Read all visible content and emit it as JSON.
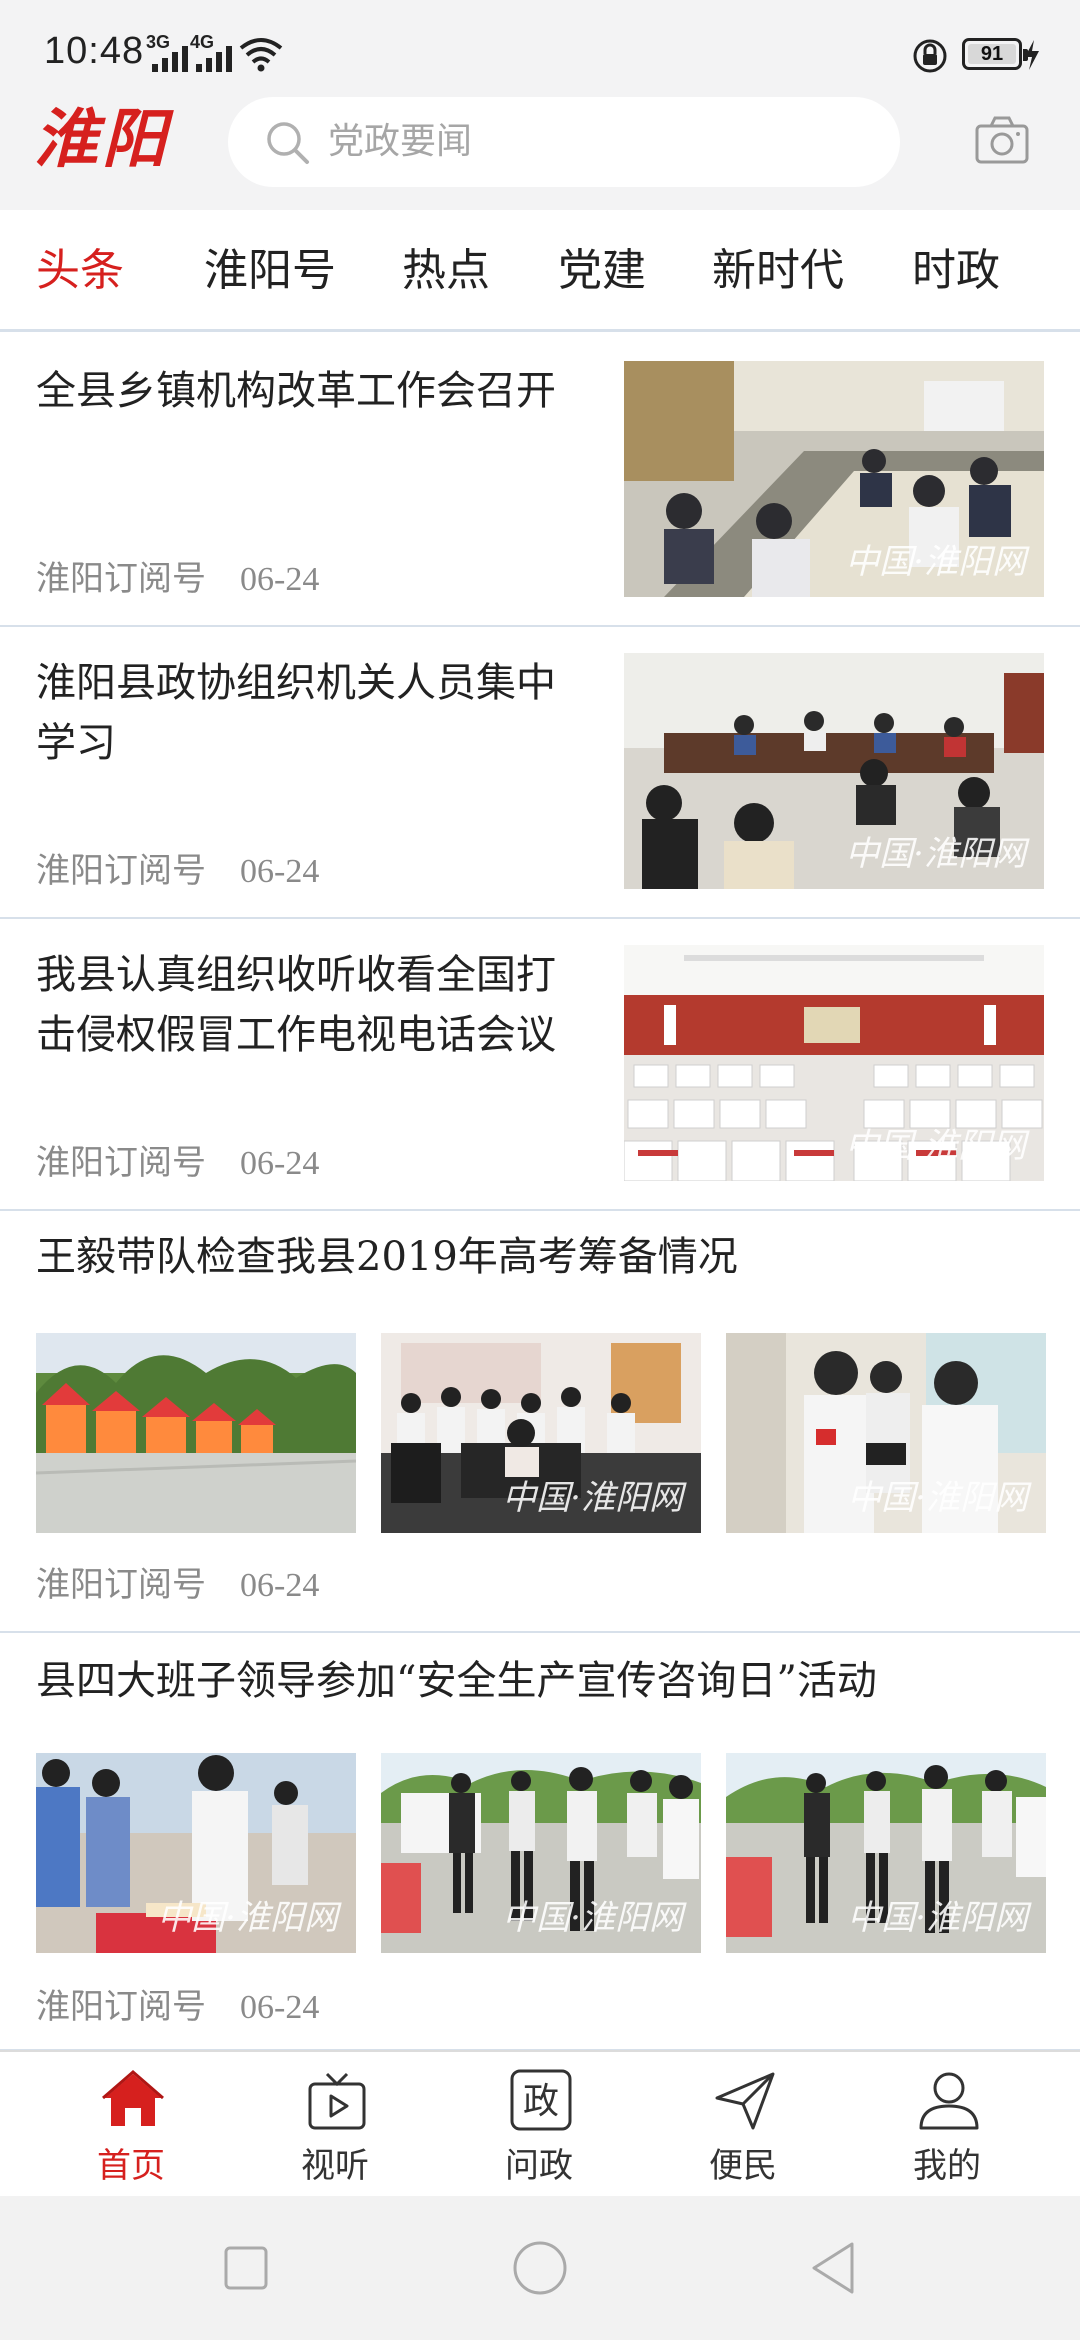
{
  "status_bar": {
    "time": "10:48",
    "network_1": "3G",
    "network_2": "4G",
    "battery": "91"
  },
  "header": {
    "logo": "淮阳",
    "search_placeholder": "党政要闻"
  },
  "tabs": [
    {
      "label": "头条",
      "active": true
    },
    {
      "label": "淮阳号",
      "active": false
    },
    {
      "label": "热点",
      "active": false
    },
    {
      "label": "党建",
      "active": false
    },
    {
      "label": "新时代",
      "active": false
    },
    {
      "label": "时政",
      "active": false
    }
  ],
  "articles": [
    {
      "title": "全县乡镇机构改革工作会召开",
      "source": "淮阳订阅号",
      "date": "06-24",
      "watermark": "中国·淮阳网"
    },
    {
      "title_line1": "淮阳县政协组织机关人员集中",
      "title_line2": "学习",
      "source": "淮阳订阅号",
      "date": "06-24",
      "watermark": "中国·淮阳网"
    },
    {
      "title_line1": "我县认真组织收听收看全国打",
      "title_line2": "击侵权假冒工作电视电话会议",
      "source": "淮阳订阅号",
      "date": "06-24",
      "watermark": "中国·淮阳网"
    },
    {
      "title": "王毅带队检查我县2019年高考筹备情况",
      "source": "淮阳订阅号",
      "date": "06-24",
      "watermark": "中国·淮阳网"
    },
    {
      "title": "县四大班子领导参加“安全生产宣传咨询日”活动",
      "source": "淮阳订阅号",
      "date": "06-24",
      "watermark": "中国·淮阳网"
    }
  ],
  "bottom_nav": [
    {
      "label": "首页",
      "icon": "home-icon",
      "active": true
    },
    {
      "label": "视听",
      "icon": "tv-icon",
      "active": false
    },
    {
      "label": "问政",
      "icon": "zheng-icon",
      "glyph": "政",
      "active": false
    },
    {
      "label": "便民",
      "icon": "send-icon",
      "active": false
    },
    {
      "label": "我的",
      "icon": "user-icon",
      "active": false
    }
  ],
  "colors": {
    "accent": "#d6201e",
    "divider": "#d7e0ea",
    "meta_text": "#8a8a8a"
  }
}
